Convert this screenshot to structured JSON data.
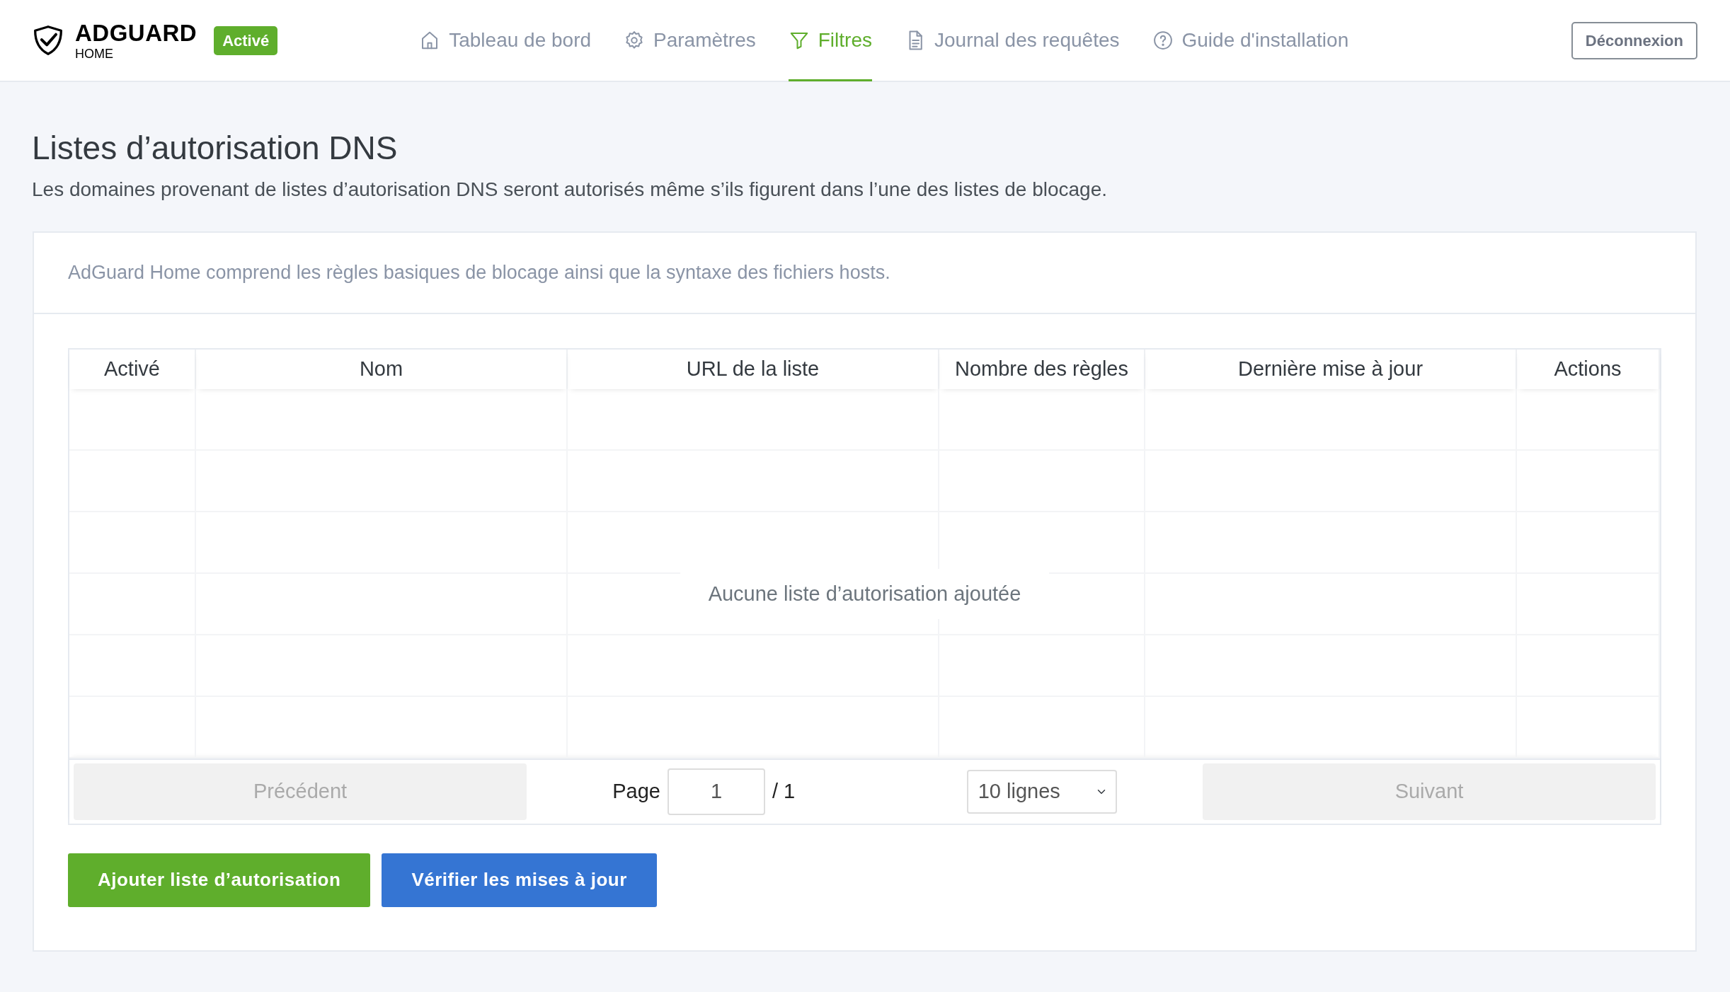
{
  "header": {
    "brand": {
      "name": "ADGUARD",
      "sub": "HOME"
    },
    "status_badge": "Activé",
    "nav": [
      {
        "label": "Tableau de bord",
        "kind": "home",
        "selected": false
      },
      {
        "label": "Paramètres",
        "kind": "settings",
        "selected": false
      },
      {
        "label": "Filtres",
        "kind": "filter",
        "selected": true
      },
      {
        "label": "Journal des requêtes",
        "kind": "log",
        "selected": false
      },
      {
        "label": "Guide d'installation",
        "kind": "help",
        "selected": false
      }
    ],
    "logout": "Déconnexion"
  },
  "page": {
    "title": "Listes d’autorisation DNS",
    "description": "Les domaines provenant de listes d’autorisation DNS seront autorisés même s’ils figurent dans l’une des listes de blocage."
  },
  "card": {
    "hint": "AdGuard Home comprend les règles basiques de blocage ainsi que la syntaxe des fichiers hosts.",
    "table": {
      "columns": [
        "Activé",
        "Nom",
        "URL de la liste",
        "Nombre des règles",
        "Dernière mise à jour",
        "Actions"
      ],
      "empty_message": "Aucune liste d’autorisation ajoutée"
    },
    "pagination": {
      "previous": {
        "label": "Précédent",
        "disabled": true
      },
      "page_label": "Page",
      "page": "1",
      "total": "/ 1",
      "page_size": "10 lignes",
      "next": {
        "label": "Suivant",
        "disabled": true
      }
    },
    "buttons": [
      {
        "label": "Ajouter liste d’autorisation"
      },
      {
        "label": "Vérifier les mises à jour"
      }
    ]
  }
}
